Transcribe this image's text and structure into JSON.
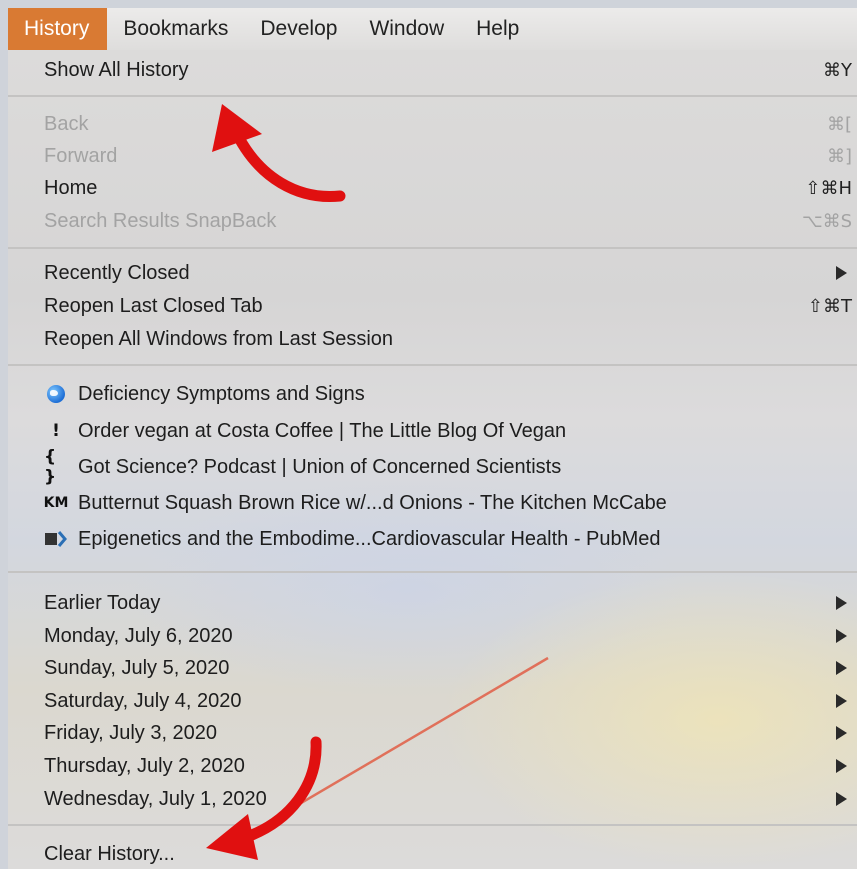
{
  "menubar": {
    "items": [
      "History",
      "Bookmarks",
      "Develop",
      "Window",
      "Help"
    ]
  },
  "menu": {
    "show_all_history": {
      "label": "Show All History",
      "shortcut": "⌘Y"
    },
    "back": {
      "label": "Back",
      "shortcut": "⌘["
    },
    "forward": {
      "label": "Forward",
      "shortcut": "⌘]"
    },
    "home": {
      "label": "Home",
      "shortcut": "⇧⌘H"
    },
    "snapback": {
      "label": "Search Results SnapBack",
      "shortcut": "⌥⌘S"
    },
    "recently_closed": {
      "label": "Recently Closed"
    },
    "reopen_last_tab": {
      "label": "Reopen Last Closed Tab",
      "shortcut": "⇧⌘T"
    },
    "reopen_all_windows": {
      "label": "Reopen All Windows from Last Session"
    },
    "recent_pages": [
      {
        "label": "Deficiency Symptoms and Signs",
        "icon": "globe-icon"
      },
      {
        "label": "Order vegan at Costa Coffee | The Little Blog Of Vegan",
        "icon": "pin-icon",
        "glyph": "!"
      },
      {
        "label": "Got Science? Podcast | Union of Concerned Scientists",
        "icon": "braces-icon",
        "glyph": "{ }"
      },
      {
        "label": "Butternut Squash Brown Rice w/...d Onions - The Kitchen McCabe",
        "icon": "km-logo-icon",
        "glyph": "KM"
      },
      {
        "label": "Epigenetics and the Embodime...Cardiovascular Health - PubMed",
        "icon": "pubmed-icon"
      }
    ],
    "days": [
      "Earlier Today",
      "Monday, July 6, 2020",
      "Sunday, July 5, 2020",
      "Saturday, July 4, 2020",
      "Friday, July 3, 2020",
      "Thursday, July 2, 2020",
      "Wednesday, July 1, 2020"
    ],
    "clear_history": {
      "label": "Clear History..."
    }
  },
  "colors": {
    "menubar_active": "#d97a33",
    "annotation_arrow": "#e01010",
    "annotation_line": "#e0705a"
  }
}
